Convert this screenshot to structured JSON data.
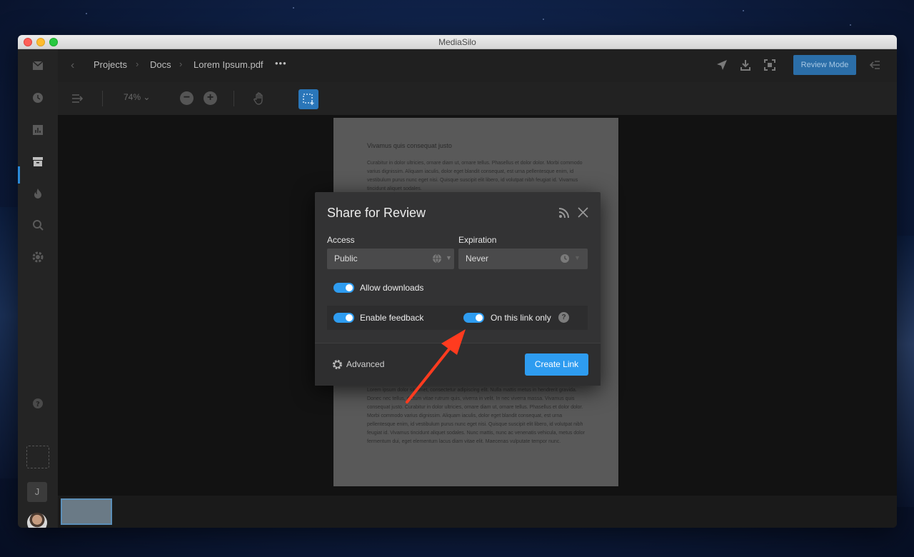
{
  "window": {
    "title": "MediaSilo"
  },
  "sidebar": {
    "icons": [
      "inbox-icon",
      "clock-icon",
      "chart-icon",
      "archive-icon",
      "fire-icon",
      "search-icon",
      "gear-icon"
    ],
    "active_item": "archive-icon",
    "user_initial": "J"
  },
  "header": {
    "breadcrumb": [
      "Projects",
      "Docs",
      "Lorem Ipsum.pdf"
    ],
    "more": "•••",
    "review_mode_label": "Review Mode"
  },
  "toolbar": {
    "zoom_level": "74%",
    "zoom_caret": "⌄",
    "zoom_out": "−",
    "zoom_in": "+"
  },
  "document": {
    "heading": "Vivamus quis consequat justo",
    "paragraph_1": "Curabitur in dolor ultricies, ornare diam ut, ornare tellus. Phasellus et dolor dolor. Morbi commodo varius dignissim. Aliquam iaculis, dolor eget blandit consequat, est urna pellentesque enim, id vestibulum purus nunc eget nisi. Quisque suscipit elit libero, id volutpat nibh feugiat id. Vivamus tincidunt aliquet sodales.",
    "paragraph_2": "Lorem ipsum dolor sit amet, consectetur adipiscing elit. Nulla mattis metus in hendrerit gravida. Donec nec tellus, dictum vitae rutrum quis, viverra in velit. In nec viverra massa. Vivamus quis consequat justo. Curabitur in dolor ultricies, ornare diam ut, ornare tellus. Phasellus et dolor dolor. Morbi commodo varius dignissim. Aliquam iaculis, dolor eget blandit consequat, est urna pellentesque enim, id vestibulum purus nunc eget nisi. Quisque suscipit elit libero, id volutpat nibh feugiat id. Vivamus tincidunt aliquet sodales. Nunc mattis, nunc ac venenatis vehicula, metus dolor fermentum dui, eget elementum lacus diam vitae elit. Maecenas vulputate tempor nunc."
  },
  "modal": {
    "title": "Share for Review",
    "access_label": "Access",
    "access_value": "Public",
    "expiration_label": "Expiration",
    "expiration_value": "Never",
    "allow_downloads_label": "Allow downloads",
    "allow_downloads_on": true,
    "enable_feedback_label": "Enable feedback",
    "enable_feedback_on": true,
    "link_only_label": "On this link only",
    "link_only_on": true,
    "help": "?",
    "advanced_label": "Advanced",
    "create_link_label": "Create Link"
  },
  "colors": {
    "accent": "#2e9cf0",
    "review_mode": "#2b6ea8",
    "annotation_arrow": "#ff3b1f"
  }
}
